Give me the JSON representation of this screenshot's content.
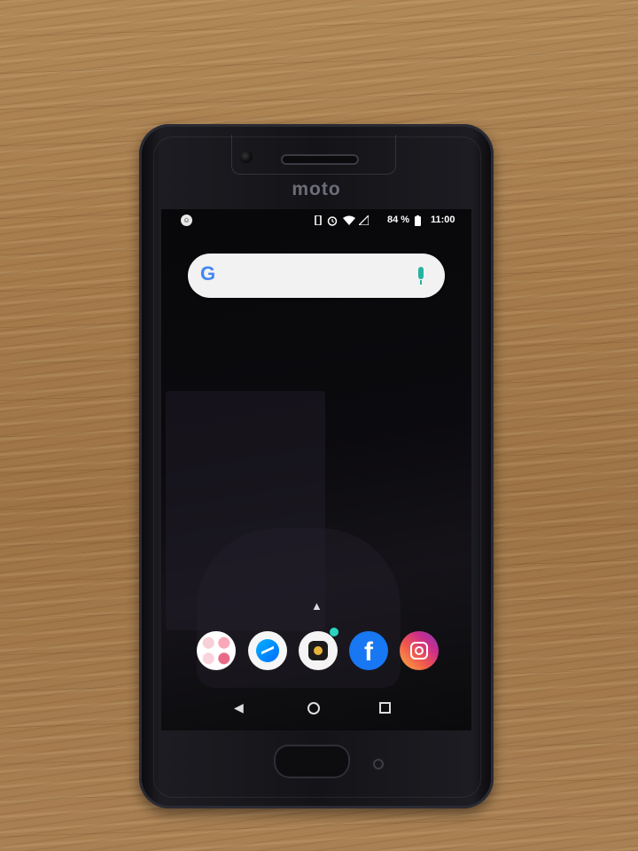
{
  "phone": {
    "logo_text": "moto"
  },
  "status_bar": {
    "battery_percent": "84 %",
    "time": "11:00",
    "icons": [
      "notification-icon",
      "vibrate-icon",
      "alarm-icon",
      "wifi-icon",
      "signal-icon",
      "battery-icon"
    ]
  },
  "search_bar": {
    "logo": "G",
    "icon": "mic-icon"
  },
  "dock": {
    "apps": [
      "photo-collage-app",
      "messenger-app",
      "camera-app",
      "facebook-app",
      "instagram-app"
    ],
    "facebook_glyph": "f"
  },
  "navigation": {
    "buttons": [
      "back",
      "home",
      "recents"
    ]
  },
  "colors": {
    "screen": "#0b0a0e",
    "facebook": "#1877f2",
    "mic": "#27b3a0"
  }
}
